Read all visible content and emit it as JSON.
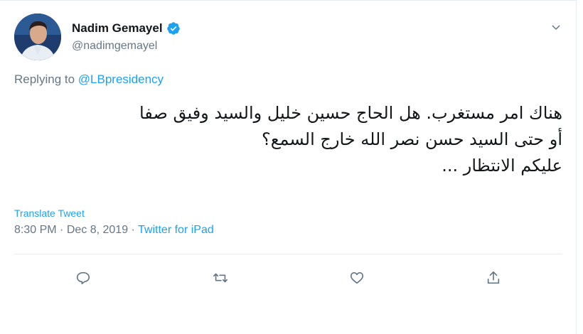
{
  "author": {
    "name": "Nadim Gemayel",
    "handle": "@nadimgemayel",
    "verified": true
  },
  "reply": {
    "prefix": "Replying to ",
    "mention": "@LBpresidency"
  },
  "tweet": {
    "lines": [
      "هناك امر مستغرب. هل الحاج حسين خليل والسيد وفيق صفا",
      "أو حتى السيد حسن نصر الله خارج السمع؟",
      "عليكم الانتظار ..."
    ]
  },
  "translate_label": "Translate Tweet",
  "meta": {
    "time": "8:30 PM",
    "sep1": " · ",
    "date": "Dec 8, 2019",
    "sep2": " · ",
    "source": "Twitter for iPad"
  },
  "icons": {
    "reply": "reply-icon",
    "retweet": "retweet-icon",
    "like": "like-icon",
    "share": "share-icon",
    "caret": "chevron-down-icon",
    "verified": "verified-badge-icon"
  },
  "colors": {
    "accent": "#1da1f2",
    "muted": "#657786",
    "text": "#14171a",
    "border": "#e6ecf0"
  }
}
